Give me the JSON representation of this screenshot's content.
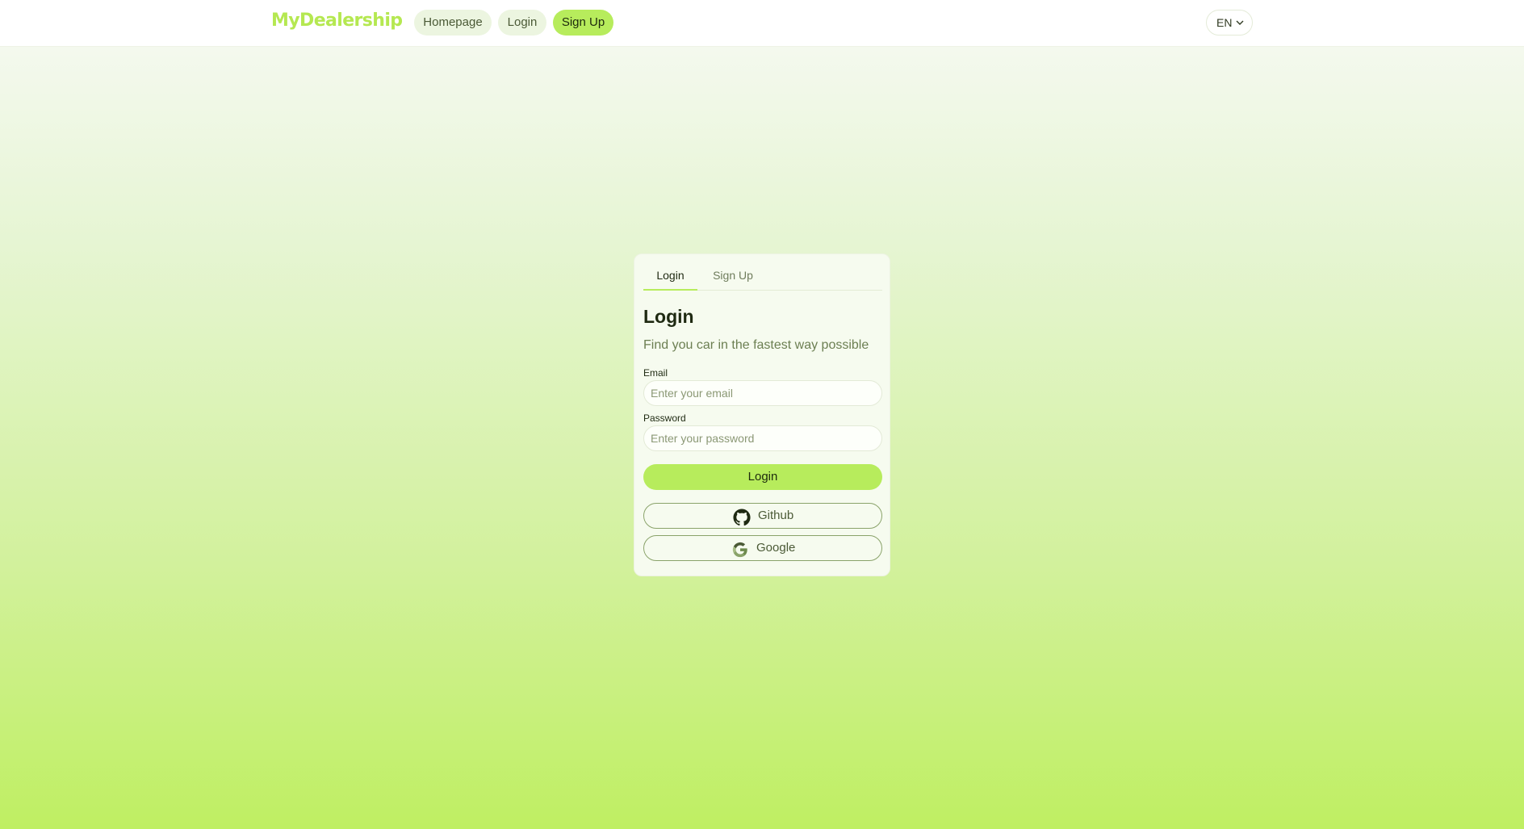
{
  "header": {
    "brand": "MyDealership",
    "nav": {
      "homepage": "Homepage",
      "login": "Login",
      "signup": "Sign Up"
    },
    "language": "EN"
  },
  "auth_card": {
    "tabs": {
      "login": "Login",
      "signup": "Sign Up"
    },
    "active_tab": "Login",
    "title": "Login",
    "subtitle": "Find you car in the fastest way possible",
    "email": {
      "label": "Email",
      "placeholder": "Enter your email",
      "value": ""
    },
    "password": {
      "label": "Password",
      "placeholder": "Enter your password",
      "value": ""
    },
    "submit_label": "Login",
    "oauth": {
      "github_label": "Github",
      "github_icon": "github-icon",
      "google_label": "Google",
      "google_icon": "google-icon"
    }
  },
  "colors": {
    "accent": "#b7ec5c",
    "brand": "#b5e851",
    "text": "#1f2a12"
  }
}
